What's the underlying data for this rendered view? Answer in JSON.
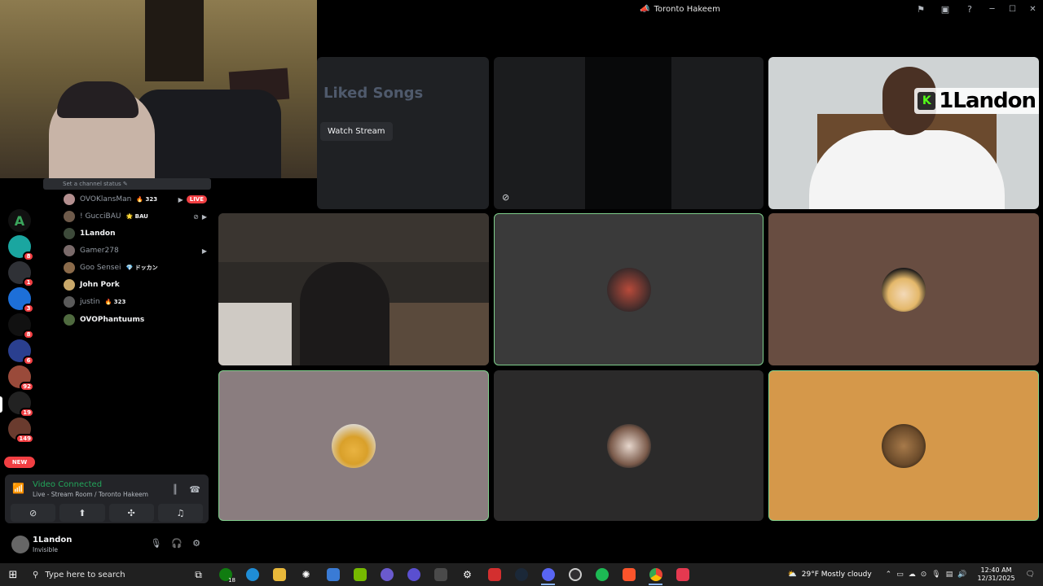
{
  "window": {
    "title": "Toronto Hakeem"
  },
  "channel": {
    "status_hint": "Set a channel status ✎",
    "members": [
      {
        "name": "OVOKlansMan",
        "tag": "🔥 323",
        "live": "LIVE",
        "bright": false
      },
      {
        "name": "! GucciBAU",
        "tag": "🌟 BAU",
        "bright": false
      },
      {
        "name": "1Landon",
        "tag": "",
        "bright": true
      },
      {
        "name": "Gamer278",
        "tag": "",
        "bright": false
      },
      {
        "name": "Goo Sensei",
        "tag": "💎 ドッカン",
        "bright": false
      },
      {
        "name": "John Pork",
        "tag": "",
        "bright": true
      },
      {
        "name": "justin",
        "tag": "🔥 323",
        "bright": false
      },
      {
        "name": "OVOPhantuums",
        "tag": "",
        "bright": true
      }
    ]
  },
  "servers": [
    {
      "label": "A",
      "badge": ""
    },
    {
      "label": "",
      "badge": "8"
    },
    {
      "label": "",
      "badge": "1"
    },
    {
      "label": "",
      "badge": "3"
    },
    {
      "label": "",
      "badge": "8"
    },
    {
      "label": "",
      "badge": "6"
    },
    {
      "label": "",
      "badge": "92"
    },
    {
      "label": "",
      "badge": "19"
    },
    {
      "label": "",
      "badge": "149"
    }
  ],
  "new_badge": "NEW",
  "voice": {
    "status": "Video Connected",
    "location": "Live - Stream Room / Toronto Hakeem"
  },
  "user": {
    "name": "1Landon",
    "status": "Invisible"
  },
  "tiles": {
    "stream_button": "Watch Stream",
    "liked_songs": "Liked Songs",
    "overlay_name": "1Landon",
    "overlay_k": "K"
  },
  "taskbar": {
    "search_placeholder": "Type here to search",
    "xbox_badge": "18",
    "weather": "29°F  Mostly cloudy",
    "time": "12:40 AM",
    "date": "12/31/2025"
  },
  "colors": {
    "tile_brown": "#684d41",
    "tile_mauve": "#8a7d7f",
    "tile_dark": "#2b2a2a",
    "tile_orange": "#d5984a",
    "tile_gray": "#3a3a3a",
    "live_red": "#f23f43",
    "connected_green": "#23a55a"
  }
}
